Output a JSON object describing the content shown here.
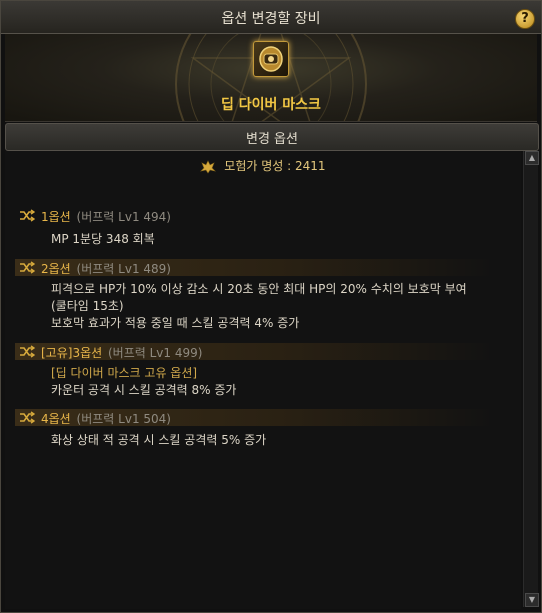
{
  "window": {
    "title": "옵션 변경할 장비",
    "help_label": "?"
  },
  "item": {
    "name": "딥 다이버 마스크",
    "icon": "helmet-mask-icon"
  },
  "section": {
    "title": "변경 옵션"
  },
  "fame": {
    "icon": "adventurer-fame-icon",
    "label": "모험가 명성 : 2411"
  },
  "options": [
    {
      "title": "1옵션",
      "level": "(버프력 Lv1 494)",
      "lines": [
        "MP 1분당 348 회복"
      ]
    },
    {
      "title": "2옵션",
      "level": "(버프력 Lv1 489)",
      "lines": [
        "피격으로 HP가 10% 이상 감소 시 20초 동안 최대 HP의 20% 수치의 보호막 부여",
        "(쿨타임 15초)",
        "보호막 효과가 적용 중일 때 스킬 공격력 4% 증가"
      ]
    },
    {
      "title": "[고유]3옵션",
      "level": "(버프력 Lv1 499)",
      "unique_label": "[딥 다이버 마스크 고유 옵션]",
      "lines": [
        "카운터 공격 시 스킬 공격력 8% 증가"
      ]
    },
    {
      "title": "4옵션",
      "level": "(버프력 Lv1 504)",
      "lines": [
        "화상 상태 적 공격 시 스킬 공격력 5% 증가"
      ]
    }
  ],
  "colors": {
    "gold": "#e8b64a",
    "item_name": "#f2c744",
    "text": "#ddd6c7"
  }
}
